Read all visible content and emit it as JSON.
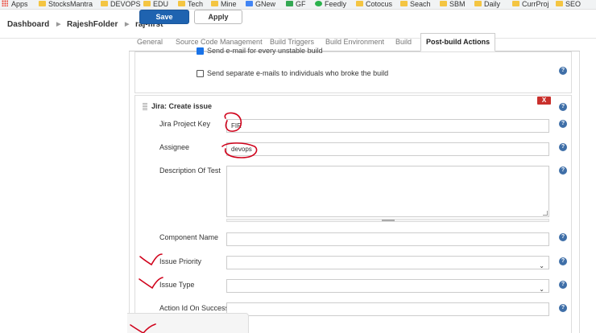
{
  "bookmarks": [
    {
      "label": "Apps",
      "icon": "apps-grid-icon"
    },
    {
      "label": "StocksMantra",
      "icon": "folder-icon"
    },
    {
      "label": "DEVOPS",
      "icon": "folder-icon"
    },
    {
      "label": "EDU",
      "icon": "folder-icon"
    },
    {
      "label": "Tech",
      "icon": "folder-icon"
    },
    {
      "label": "Mine",
      "icon": "folder-icon"
    },
    {
      "label": "GNew",
      "icon": "gnews-icon"
    },
    {
      "label": "GF",
      "icon": "gf-icon"
    },
    {
      "label": "Feedly",
      "icon": "feedly-icon"
    },
    {
      "label": "Cotocus",
      "icon": "folder-icon"
    },
    {
      "label": "Seach",
      "icon": "folder-icon"
    },
    {
      "label": "SBM",
      "icon": "folder-icon"
    },
    {
      "label": "Daily",
      "icon": "folder-icon"
    },
    {
      "label": "CurrProj",
      "icon": "folder-icon"
    },
    {
      "label": "SEO",
      "icon": "folder-icon"
    }
  ],
  "breadcrumb": [
    "Dashboard",
    "RajeshFolder",
    "raj-first"
  ],
  "tabs": [
    "General",
    "Source Code Management",
    "Build Triggers",
    "Build Environment",
    "Build",
    "Post-build Actions"
  ],
  "email_section": {
    "unstable_label": "Send e-mail for every unstable build",
    "separate_label": "Send separate e-mails to individuals who broke the build"
  },
  "jira_section": {
    "title": "Jira: Create issue",
    "close_label": "X",
    "fields": {
      "project_key_label": "Jira Project Key",
      "project_key_value": "FIR",
      "assignee_label": "Assignee",
      "assignee_value": "devops",
      "description_label": "Description Of Test",
      "component_label": "Component Name",
      "priority_label": "Issue Priority",
      "issue_type_label": "Issue Type",
      "action_id_label": "Action Id On Success"
    }
  },
  "buttons": {
    "save": "Save",
    "apply": "Apply"
  },
  "colors": {
    "accent": "#1f63b0",
    "annotation": "#d0021b",
    "close": "#c9302c"
  }
}
